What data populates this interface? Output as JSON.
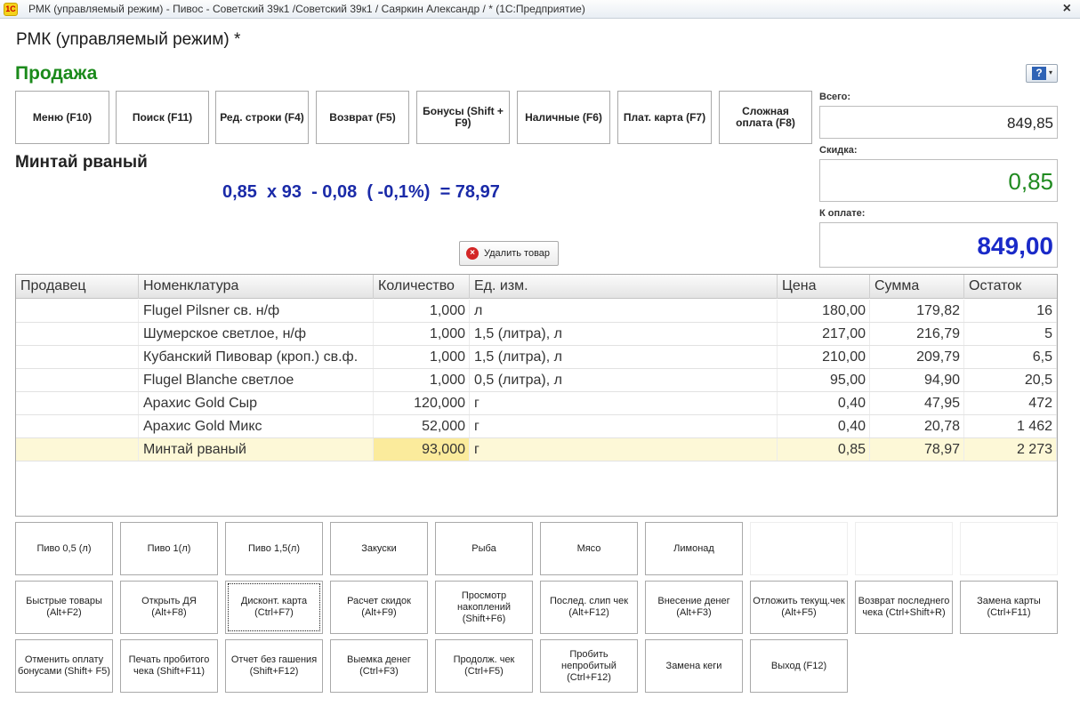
{
  "window": {
    "app_logo": "1С",
    "title": "РМК (управляемый режим) - Пивос - Советский 39к1 /Советский 39к1 / Саяркин Александр / * (1С:Предприятие)",
    "close_glyph": "×"
  },
  "form": {
    "header": "РМК (управляемый режим) *",
    "section_title": "Продажа",
    "help_glyph": "?",
    "help_arrow": "▾"
  },
  "function_buttons": [
    {
      "label": "Меню (F10)"
    },
    {
      "label": "Поиск (F11)"
    },
    {
      "label": "Ред. строки (F4)"
    },
    {
      "label": "Возврат (F5)"
    },
    {
      "label": "Бонусы (Shift + F9)"
    },
    {
      "label": "Наличные (F6)"
    },
    {
      "label": "Плат. карта (F7)"
    },
    {
      "label": "Сложная оплата (F8)"
    }
  ],
  "current_item": {
    "name": "Минтай рваный",
    "calc_line": "0,85  х 93  - 0,08  ( -0,1%)  = 78,97",
    "delete_label": "Удалить товар",
    "delete_icon": "×"
  },
  "totals": {
    "total_label": "Всего:",
    "total_value": "849,85",
    "discount_label": "Скидка:",
    "discount_value": "0,85",
    "pay_label": "К оплате:",
    "pay_value": "849,00"
  },
  "table": {
    "columns": [
      "Продавец",
      "Номенклатура",
      "Количество",
      "Ед. изм.",
      "Цена",
      "Сумма",
      "Остаток"
    ],
    "rows": [
      {
        "seller": "",
        "item": "Flugel Pilsner св. н/ф",
        "qty": "1,000",
        "unit": "л",
        "price": "180,00",
        "sum": "179,82",
        "stock": "16"
      },
      {
        "seller": "",
        "item": "Шумерское светлое, н/ф",
        "qty": "1,000",
        "unit": "1,5 (литра), л",
        "price": "217,00",
        "sum": "216,79",
        "stock": "5"
      },
      {
        "seller": "",
        "item": "Кубанский Пивовар (кроп.) св.ф.",
        "qty": "1,000",
        "unit": "1,5 (литра), л",
        "price": "210,00",
        "sum": "209,79",
        "stock": "6,5"
      },
      {
        "seller": "",
        "item": "Flugel Blanche светлое",
        "qty": "1,000",
        "unit": "0,5 (литра), л",
        "price": "95,00",
        "sum": "94,90",
        "stock": "20,5"
      },
      {
        "seller": "",
        "item": "Арахис Gold Сыр",
        "qty": "120,000",
        "unit": "г",
        "price": "0,40",
        "sum": "47,95",
        "stock": "472"
      },
      {
        "seller": "",
        "item": "Арахис Gold Микс",
        "qty": "52,000",
        "unit": "г",
        "price": "0,40",
        "sum": "20,78",
        "stock": "1 462"
      },
      {
        "seller": "",
        "item": "Минтай рваный",
        "qty": "93,000",
        "unit": "г",
        "price": "0,85",
        "sum": "78,97",
        "stock": "2 273"
      }
    ]
  },
  "quick_buttons": {
    "row1": [
      "Пиво 0,5 (л)",
      "Пиво 1(л)",
      "Пиво 1,5(л)",
      "Закуски",
      "Рыба",
      "Мясо",
      "Лимонад",
      "",
      "",
      ""
    ],
    "row2": [
      "Быстрые товары (Alt+F2)",
      "Открыть ДЯ (Alt+F8)",
      "Дисконт. карта (Ctrl+F7)",
      "Расчет скидок (Alt+F9)",
      "Просмотр накоплений (Shift+F6)",
      "Послед. слип чек (Alt+F12)",
      "Внесение денег (Alt+F3)",
      "Отложить текущ.чек (Alt+F5)",
      "Возврат последнего чека (Ctrl+Shift+R)",
      "Замена карты (Ctrl+F11)"
    ],
    "row3": [
      "Отменить оплату бонусами (Shift+ F5)",
      "Печать пробитого чека (Shift+F11)",
      "Отчет без гашения (Shift+F12)",
      "Выемка денег (Ctrl+F3)",
      "Продолж. чек (Ctrl+F5)",
      "Пробить непробитый (Ctrl+F12)",
      "Замена кеги",
      "Выход (F12)"
    ]
  }
}
